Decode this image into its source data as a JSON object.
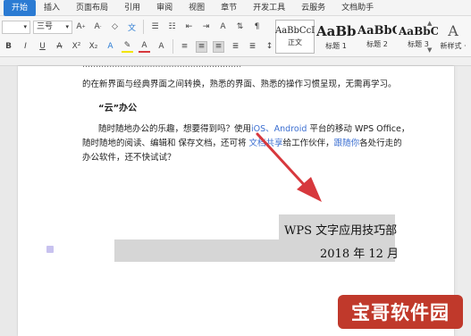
{
  "tabs": [
    "开始",
    "插入",
    "页面布局",
    "引用",
    "审阅",
    "视图",
    "章节",
    "开发工具",
    "云服务",
    "文档助手"
  ],
  "font": {
    "name": "",
    "size": "三号"
  },
  "styles": [
    {
      "sample": "AaBbCcDd",
      "name": "正文"
    },
    {
      "sample": "AaBb",
      "name": "标题 1"
    },
    {
      "sample": "AaBbC",
      "name": "标题 2"
    },
    {
      "sample": "AaBbC",
      "name": "标题 3"
    }
  ],
  "new_style": {
    "glyph": "A",
    "label": "新样式 ·"
  },
  "doc": {
    "line0": "的在新界面与经典界面之间转换，熟悉的界面、熟悉的操作习惯呈现，无需再学习。",
    "heading": "“云”办公",
    "para_a1": "随时随地办公的乐趣，想要得到吗？使用",
    "para_a2": "iOS、Android",
    "para_a3": " 平台的移动 WPS Office，",
    "para_b": "随时随地的阅读、编辑和 保存文档，还可将",
    "para_b_link1": " 文档共享",
    "para_b_mid": "给工作伙伴，",
    "para_b_link2": "跟随你",
    "para_b_end": "各处行走的",
    "para_c": "办公软件，还不快试试？",
    "wps_title": "WPS 文字应用技巧部",
    "date": "2018 年 12 月"
  },
  "watermark": "宝哥软件园",
  "colors": {
    "accent": "#2b7bd3",
    "arrow": "#d7383d",
    "highlight": "#d6d6d6",
    "watermark": "#c0392b"
  }
}
